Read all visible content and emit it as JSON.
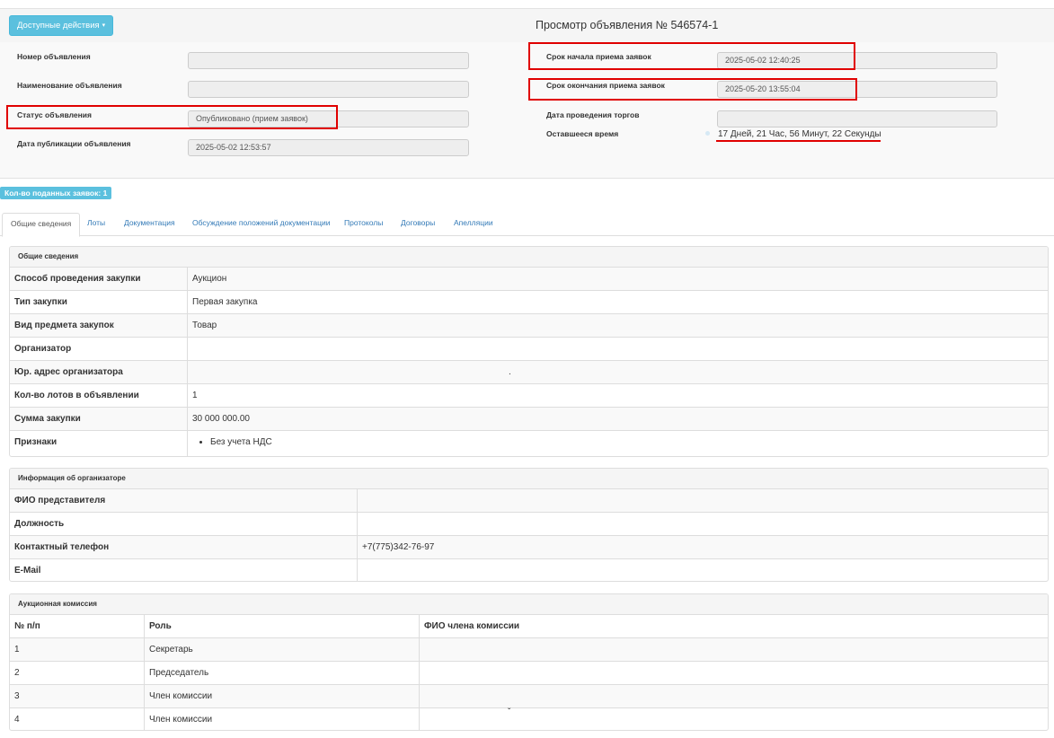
{
  "header": {
    "actions_label": "Доступные действия",
    "title": "Просмотр объявления № 546574-1"
  },
  "form": {
    "left": [
      {
        "label": "Номер объявления",
        "value": ""
      },
      {
        "label": "Наименование объявления",
        "value": ""
      },
      {
        "label": "Статус объявления",
        "value": "Опубликовано (прием заявок)"
      },
      {
        "label": "Дата публикации объявления",
        "value": "2025-05-02 12:53:57"
      }
    ],
    "right": [
      {
        "label": "Срок начала приема заявок",
        "value": "2025-05-02 12:40:25"
      },
      {
        "label": "Срок окончания приема заявок",
        "value": "2025-05-20 13:55:04"
      },
      {
        "label": "Дата проведения торгов",
        "value": ""
      },
      {
        "label": "Оставшееся время",
        "value": "17 Дней, 21 Час, 56 Минут, 22 Секунды"
      }
    ]
  },
  "applications_badge": "Кол-во поданных заявок: 1",
  "tabs": [
    {
      "label": "Общие сведения",
      "active": true
    },
    {
      "label": "Лоты",
      "active": false
    },
    {
      "label": "Документация",
      "active": false
    },
    {
      "label": "Обсуждение положений документации",
      "active": false
    },
    {
      "label": "Протоколы",
      "active": false
    },
    {
      "label": "Договоры",
      "active": false
    },
    {
      "label": "Апелляции",
      "active": false
    }
  ],
  "general": {
    "heading": "Общие сведения",
    "rows": [
      {
        "label": "Способ проведения закупки",
        "value": "Аукцион"
      },
      {
        "label": "Тип закупки",
        "value": "Первая закупка"
      },
      {
        "label": "Вид предмета закупок",
        "value": "Товар"
      },
      {
        "label": "Организатор",
        "value": ""
      },
      {
        "label": "Юр. адрес организатора",
        "value": "."
      },
      {
        "label": "Кол-во лотов в объявлении",
        "value": "1"
      },
      {
        "label": "Сумма закупки",
        "value": "30 000 000.00"
      },
      {
        "label": "Признаки",
        "value": "Без учета НДС"
      }
    ]
  },
  "organizer": {
    "heading": "Информация об организаторе",
    "rows": [
      {
        "label": "ФИО представителя",
        "value": ""
      },
      {
        "label": "Должность",
        "value": ""
      },
      {
        "label": "Контактный телефон",
        "value": "+7(775)342-76-97"
      },
      {
        "label": "E-Mail",
        "value": ""
      }
    ]
  },
  "commission": {
    "heading": "Аукционная комиссия",
    "columns": [
      "№ п/п",
      "Роль",
      "ФИО члена комиссии"
    ],
    "rows": [
      {
        "num": "1",
        "role": "Секретарь",
        "name": ""
      },
      {
        "num": "2",
        "role": "Председатель",
        "name": ""
      },
      {
        "num": "3",
        "role": "Член комиссии",
        "name": ""
      },
      {
        "num": "4",
        "role": "Член комиссии",
        "name": "ˇ"
      }
    ]
  },
  "colors": {
    "accent": "#5bc0de",
    "link": "#337ab7",
    "highlight": "#e00000"
  }
}
